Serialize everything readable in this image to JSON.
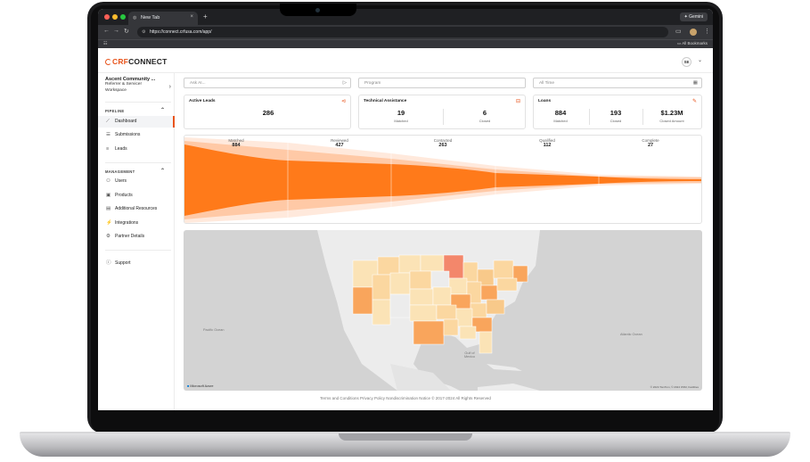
{
  "browser": {
    "tab_title": "New Tab",
    "gemini_label": "Gemini",
    "url": "https://connect.crfusa.com/app/",
    "bookmarks_label": "All Bookmarks"
  },
  "app": {
    "brand_crf": "CRF",
    "brand_connect": "CONNECT",
    "user_initials": "SE",
    "workspace": {
      "name": "Ascent Community ...",
      "line1": "Referrer & Servicer",
      "line2": "Workspace"
    },
    "sidebar": {
      "pipeline_label": "PIPELINE",
      "pipeline_items": [
        "Dashboard",
        "Submissions",
        "Leads"
      ],
      "management_label": "MANAGEMENT",
      "management_items": [
        "Users",
        "Products",
        "Additional Resources",
        "Integrations",
        "Partner Details"
      ],
      "support_label": "Support"
    },
    "filters": {
      "ask_placeholder": "Ask AI...",
      "program_placeholder": "Program",
      "time_value": "All Time"
    },
    "cards": {
      "active_leads": {
        "title": "Active Leads",
        "value": "286"
      },
      "technical_assistance": {
        "title": "Technical Assistance",
        "matched": "19",
        "matched_label": "Matched",
        "closed": "6",
        "closed_label": "Closed"
      },
      "loans": {
        "title": "Loans",
        "matched": "884",
        "matched_label": "Matched",
        "closed": "193",
        "closed_label": "Closed",
        "amount": "$1.23M",
        "amount_label": "Closed Amount"
      }
    },
    "funnel": {
      "stages": [
        {
          "label": "Matched",
          "value": "884"
        },
        {
          "label": "Reviewed",
          "value": "427"
        },
        {
          "label": "Contacted",
          "value": "263"
        },
        {
          "label": "Qualified",
          "value": "112"
        },
        {
          "label": "Complete",
          "value": "27"
        }
      ]
    },
    "map": {
      "pacific_label": "Pacific Ocean",
      "atlantic_label": "Atlantic Ocean",
      "gulf_label": "Gulf of Mexico",
      "provider": "Microsoft Azure",
      "attribution": "© 2024 TomTom, © 2024 OSM, Facilities"
    },
    "footer": "Terms and Conditions    Privacy Policy    Nondiscrimination Notice    © 2017-2024 All Rights Reserved"
  }
}
